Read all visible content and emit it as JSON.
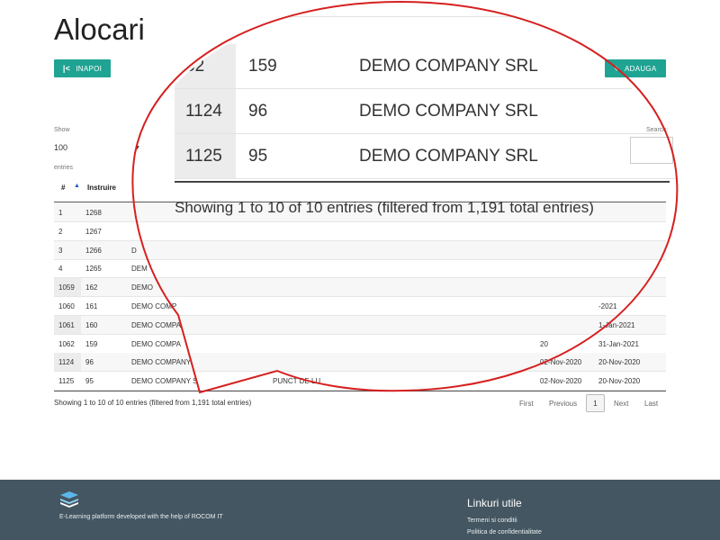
{
  "page": {
    "title": "Alocari"
  },
  "toolbar": {
    "back_label": "INAPOI",
    "back_icon": "chevron-left-icon",
    "add_label": "ADAUGA",
    "add_icon": "plus-icon",
    "accent": "#1fa392"
  },
  "table_controls": {
    "show_label": "Show",
    "length_value": "100",
    "entries_label": "entries",
    "search_label": "Search:"
  },
  "table": {
    "headers": {
      "num": "#",
      "instruire": "Instruire"
    },
    "rows": [
      {
        "num": "1",
        "instr": "1268",
        "company": "",
        "point": "",
        "date1": "",
        "date2": ""
      },
      {
        "num": "2",
        "instr": "1267",
        "company": "",
        "point": "",
        "date1": "",
        "date2": ""
      },
      {
        "num": "3",
        "instr": "1266",
        "company": "D",
        "point": "",
        "date1": "",
        "date2": ""
      },
      {
        "num": "4",
        "instr": "1265",
        "company": "DEM",
        "point": "",
        "date1": "",
        "date2": ""
      },
      {
        "num": "1059",
        "instr": "162",
        "company": "DEMO",
        "point": "",
        "date1": "",
        "date2": ""
      },
      {
        "num": "1060",
        "instr": "161",
        "company": "DEMO COMP",
        "point": "",
        "date1": "",
        "date2": "-2021"
      },
      {
        "num": "1061",
        "instr": "160",
        "company": "DEMO COMPA",
        "point": "",
        "date1": "",
        "date2": "1-Jan-2021"
      },
      {
        "num": "1062",
        "instr": "159",
        "company": "DEMO COMPA",
        "point": "",
        "date1": "20",
        "date2": "31-Jan-2021"
      },
      {
        "num": "1124",
        "instr": "96",
        "company": "DEMO COMPANY",
        "point": "",
        "date1": "02-Nov-2020",
        "date2": "20-Nov-2020"
      },
      {
        "num": "1125",
        "instr": "95",
        "company": "DEMO COMPANY S",
        "point": "PUNCT DE LU",
        "date1": "02-Nov-2020",
        "date2": "20-Nov-2020"
      }
    ],
    "info": "Showing 1 to 10 of 10 entries (filtered from 1,191 total entries)"
  },
  "pagination": {
    "first": "First",
    "previous": "Previous",
    "current": "1",
    "next": "Next",
    "last": "Last"
  },
  "zoom_callout": {
    "rows": [
      {
        "num": "",
        "instr": "",
        "company": "DEMO COMPA"
      },
      {
        "num": "62",
        "instr": "159",
        "company": "DEMO COMPANY SRL"
      },
      {
        "num": "1124",
        "instr": "96",
        "company": "DEMO COMPANY SRL"
      },
      {
        "num": "1125",
        "instr": "95",
        "company": "DEMO COMPANY SRL"
      }
    ],
    "info": "Showing 1 to 10 of 10 entries (filtered from 1,191 total entries)",
    "border_color": "#d62020"
  },
  "footer": {
    "logo_icon": "stacked-books-logo-icon",
    "text": "E-Learning platform developed with the help of ROCOM IT",
    "links_title": "Linkuri utile",
    "links": [
      "Termeni si conditii",
      "Politica de confidentialitate"
    ],
    "background": "#445661"
  }
}
